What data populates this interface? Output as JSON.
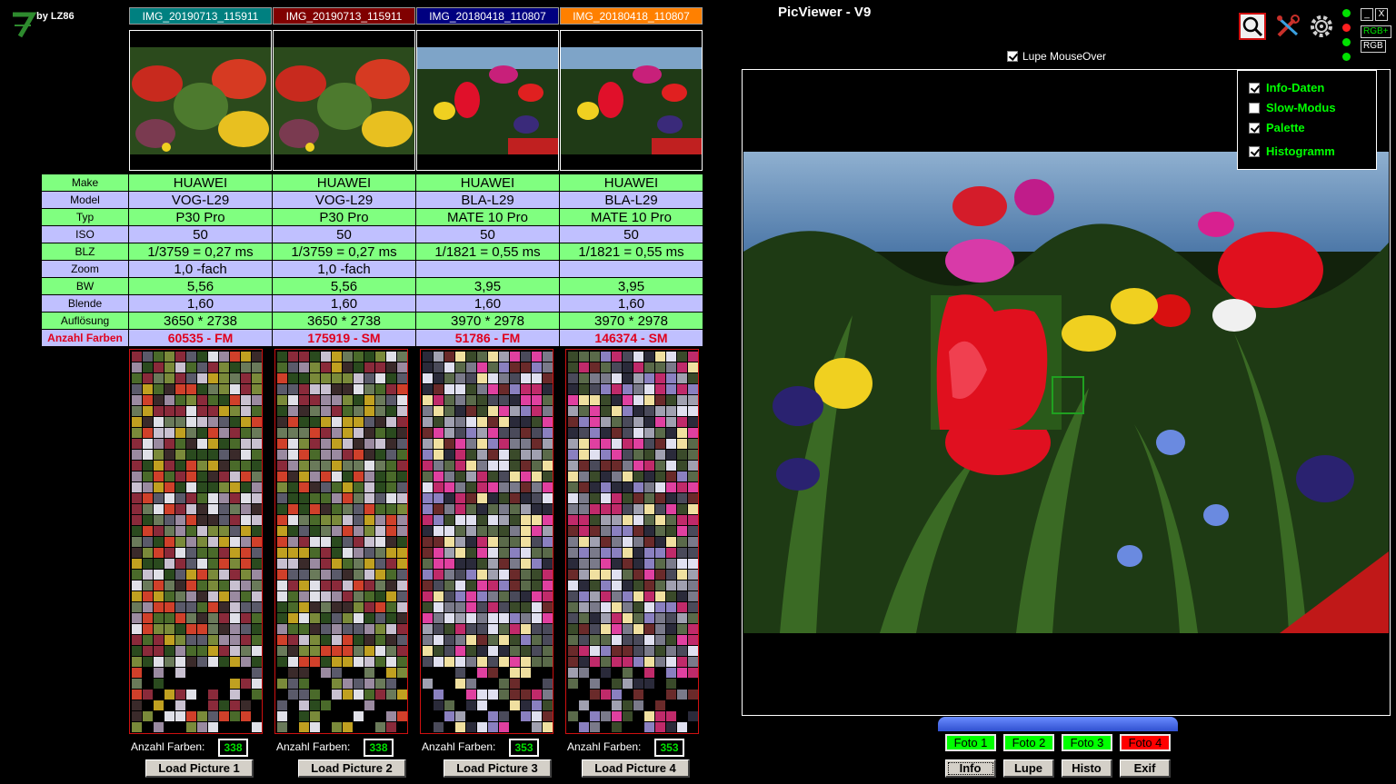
{
  "app": {
    "title": "PicViewer - V9",
    "credit": "by LZ86"
  },
  "tabs": [
    {
      "label": "IMG_20190713_115911",
      "color": "#008080"
    },
    {
      "label": "IMG_20190713_115911",
      "color": "#800000"
    },
    {
      "label": "IMG_20180418_110807",
      "color": "#000080"
    },
    {
      "label": "IMG_20180418_110807",
      "color": "#ff8000"
    }
  ],
  "exif_table": {
    "rows": [
      {
        "label": "Make",
        "values": [
          "HUAWEI",
          "HUAWEI",
          "HUAWEI",
          "HUAWEI"
        ]
      },
      {
        "label": "Model",
        "values": [
          "VOG-L29",
          "VOG-L29",
          "BLA-L29",
          "BLA-L29"
        ]
      },
      {
        "label": "Typ",
        "values": [
          "P30 Pro",
          "P30 Pro",
          "MATE 10 Pro",
          "MATE 10 Pro"
        ]
      },
      {
        "label": "ISO",
        "values": [
          "50",
          "50",
          "50",
          "50"
        ]
      },
      {
        "label": "BLZ",
        "values": [
          "1/3759 = 0,27 ms",
          "1/3759 = 0,27 ms",
          "1/1821 = 0,55 ms",
          "1/1821 = 0,55 ms"
        ]
      },
      {
        "label": "Zoom",
        "values": [
          "1,0 -fach",
          "1,0 -fach",
          "",
          ""
        ]
      },
      {
        "label": "BW",
        "values": [
          "5,56",
          "5,56",
          "3,95",
          "3,95"
        ]
      },
      {
        "label": "Blende",
        "values": [
          "1,60",
          "1,60",
          "1,60",
          "1,60"
        ]
      },
      {
        "label": "Auflösung",
        "values": [
          "3650 * 2738",
          "3650 * 2738",
          "3970 * 2978",
          "3970 * 2978"
        ]
      },
      {
        "label": "Anzahl Farben",
        "values": [
          "60535 - FM",
          "175919 - SM",
          "51786 - FM",
          "146374 - SM"
        ]
      }
    ]
  },
  "palettes": [
    {
      "count_label": "Anzahl Farben:",
      "count": "338",
      "load_label": "Load Picture 1"
    },
    {
      "count_label": "Anzahl Farben:",
      "count": "338",
      "load_label": "Load Picture 2"
    },
    {
      "count_label": "Anzahl Farben:",
      "count": "353",
      "load_label": "Load Picture 3"
    },
    {
      "count_label": "Anzahl Farben:",
      "count": "353",
      "load_label": "Load Picture 4"
    }
  ],
  "lupe": {
    "label": "Lupe MouseOver",
    "checked": true
  },
  "options": [
    {
      "label": "Info-Daten",
      "checked": true
    },
    {
      "label": "Slow-Modus",
      "checked": false
    },
    {
      "label": "Palette",
      "checked": true
    },
    {
      "label": "Histogramm",
      "checked": true
    }
  ],
  "toolbar": {
    "icons": [
      "magnifier-icon",
      "tools-icon",
      "gear-icon"
    ],
    "min_label": "_",
    "close_label": "X",
    "rgb_plus_label": "RGB+",
    "rgb_label": "RGB"
  },
  "status_dots": [
    "#00e000",
    "#ff2020",
    "#00e000",
    "#00e000"
  ],
  "foto_buttons": [
    {
      "label": "Foto 1",
      "color": "#00ff00"
    },
    {
      "label": "Foto 2",
      "color": "#00ff00"
    },
    {
      "label": "Foto 3",
      "color": "#00ff00"
    },
    {
      "label": "Foto 4",
      "color": "#ff0000"
    }
  ],
  "bottom_buttons": [
    {
      "label": "Info"
    },
    {
      "label": "Lupe"
    },
    {
      "label": "Histo"
    },
    {
      "label": "Exif"
    }
  ]
}
